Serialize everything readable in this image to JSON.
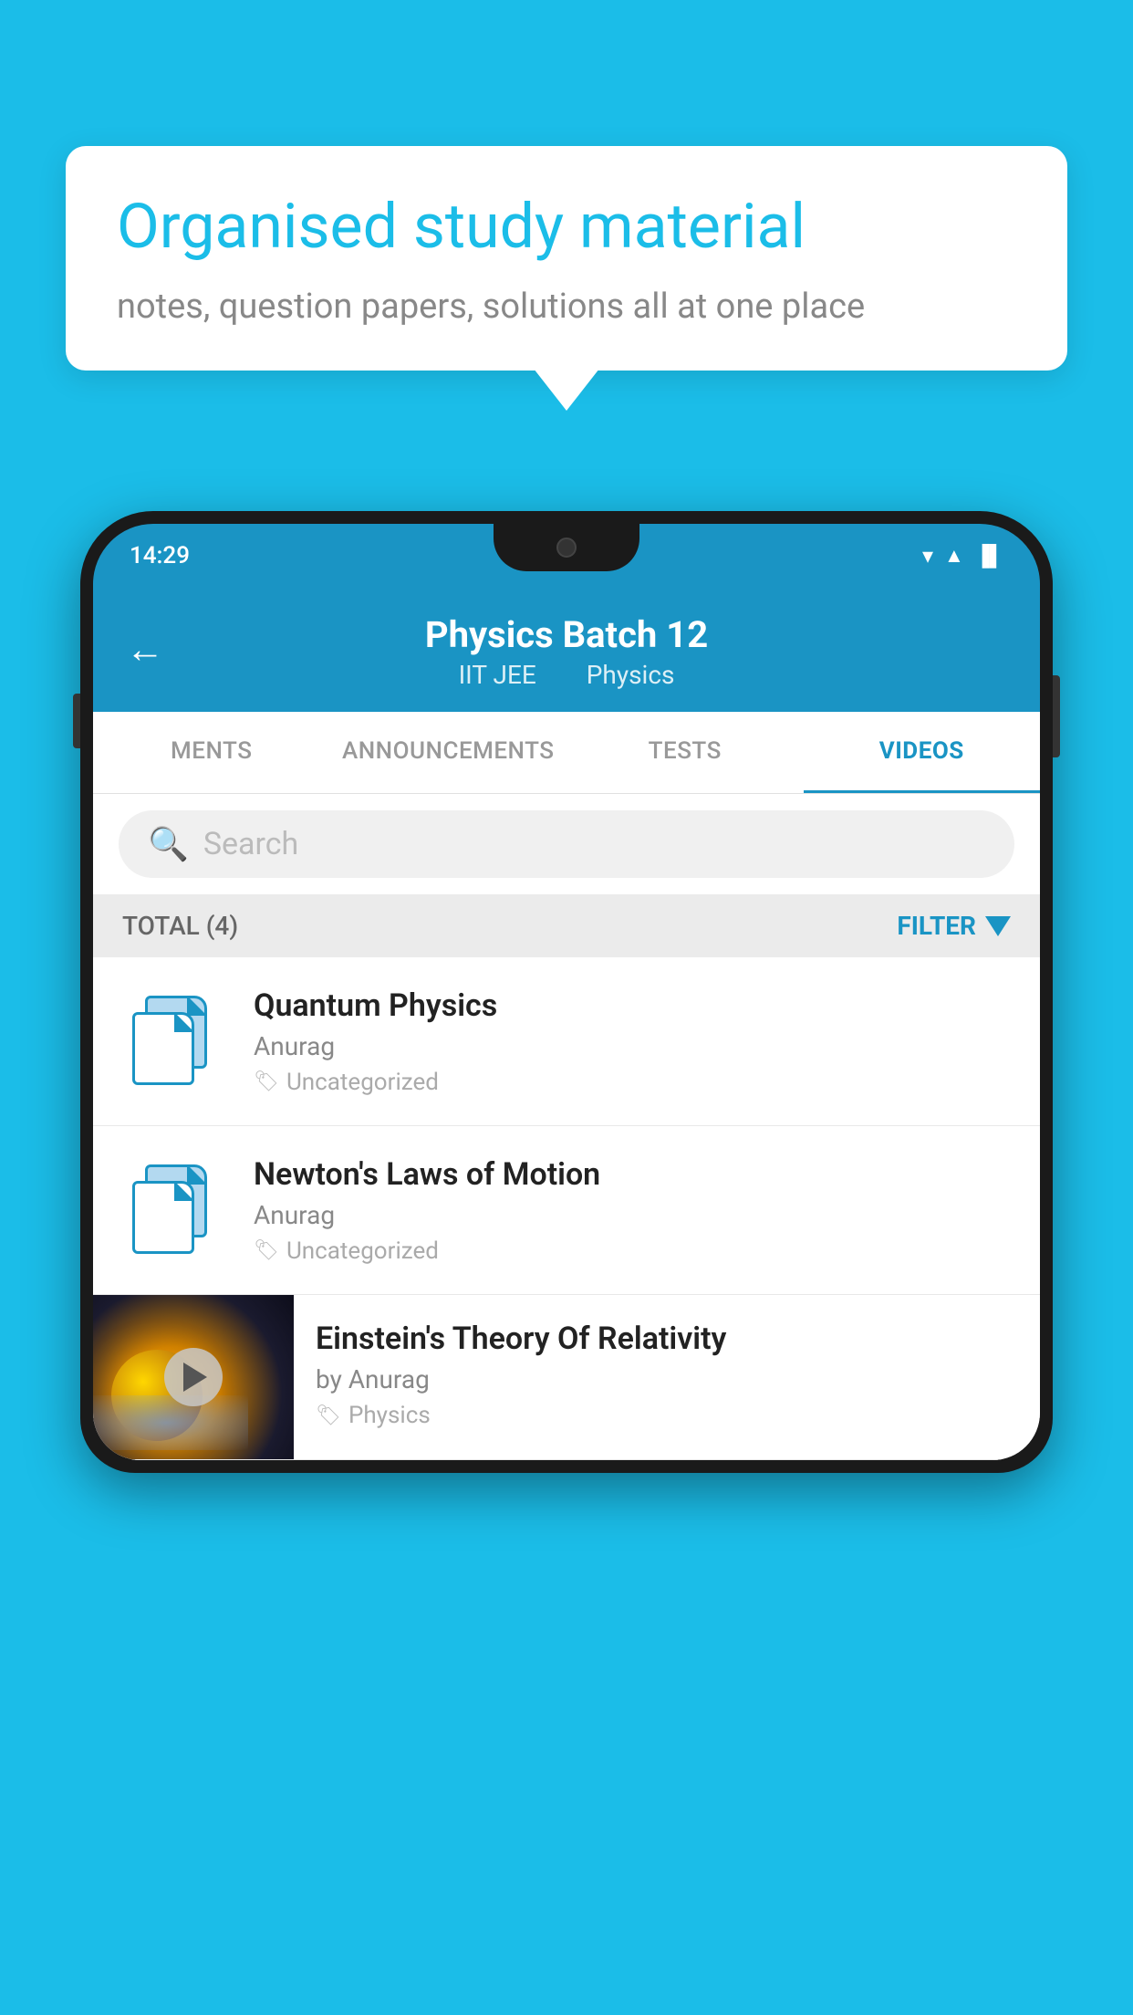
{
  "background_color": "#1bbde8",
  "bubble": {
    "title": "Organised study material",
    "subtitle": "notes, question papers, solutions all at one place"
  },
  "phone": {
    "status_bar": {
      "time": "14:29",
      "wifi": "▼",
      "signal": "▲",
      "battery": "▐"
    },
    "header": {
      "back_icon": "←",
      "title": "Physics Batch 12",
      "tag1": "IIT JEE",
      "tag2": "Physics"
    },
    "tabs": [
      {
        "label": "MENTS",
        "active": false
      },
      {
        "label": "ANNOUNCEMENTS",
        "active": false
      },
      {
        "label": "TESTS",
        "active": false
      },
      {
        "label": "VIDEOS",
        "active": true
      }
    ],
    "search": {
      "placeholder": "Search"
    },
    "filter_bar": {
      "total_label": "TOTAL (4)",
      "filter_label": "FILTER"
    },
    "videos": [
      {
        "id": "1",
        "title": "Quantum Physics",
        "author": "Anurag",
        "tag": "Uncategorized",
        "has_thumbnail": false
      },
      {
        "id": "2",
        "title": "Newton's Laws of Motion",
        "author": "Anurag",
        "tag": "Uncategorized",
        "has_thumbnail": false
      },
      {
        "id": "3",
        "title": "Einstein's Theory Of Relativity",
        "author": "by Anurag",
        "tag": "Physics",
        "has_thumbnail": true
      }
    ]
  }
}
